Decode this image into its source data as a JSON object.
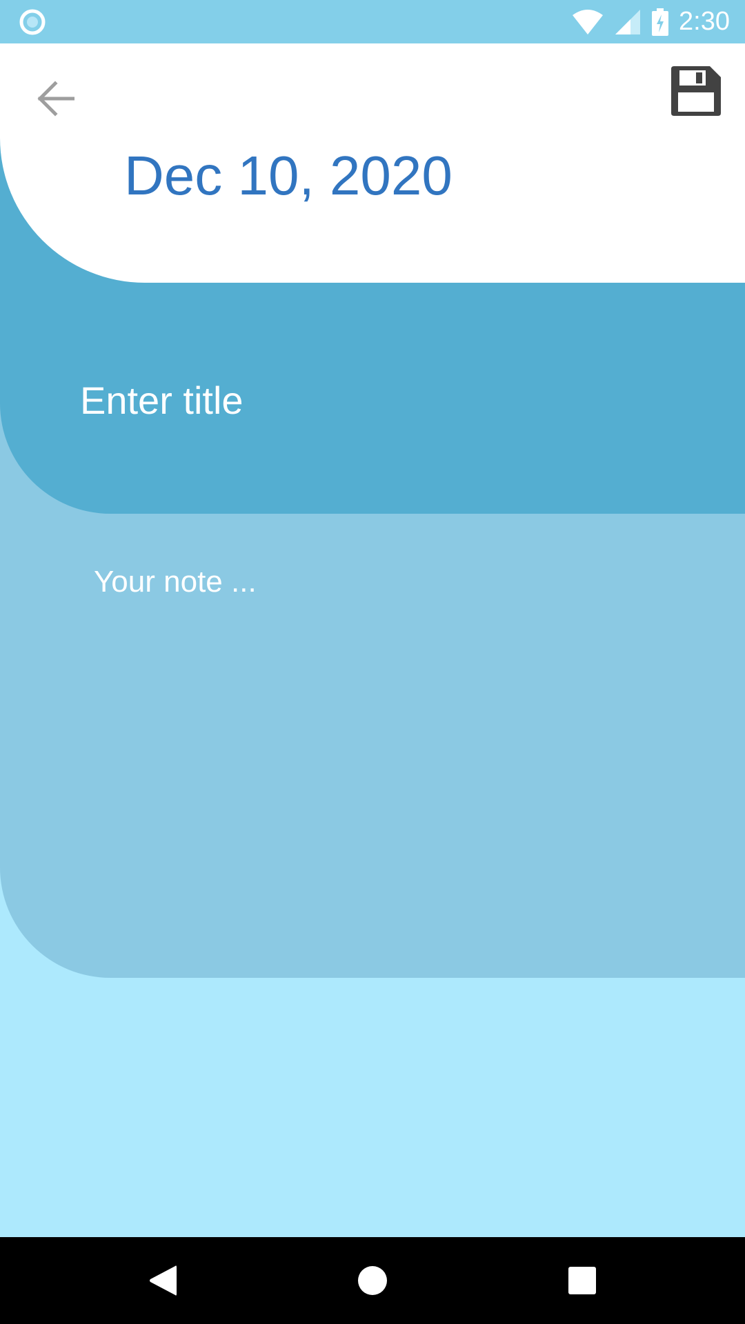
{
  "status_bar": {
    "time": "2:30",
    "icons": [
      "app-notification-icon",
      "wifi-icon",
      "cell-signal-icon",
      "battery-charging-icon"
    ],
    "background": "#83cfe9"
  },
  "header": {
    "date": "Dec 10, 2020",
    "back_icon": "arrow-left-icon",
    "save_icon": "floppy-disk-icon",
    "date_color": "#3175c0"
  },
  "title_field": {
    "placeholder": "Enter title",
    "value": ""
  },
  "note_field": {
    "placeholder": "Your note ...",
    "value": ""
  },
  "nav_bar": {
    "icons": [
      "nav-back-icon",
      "nav-home-icon",
      "nav-recents-icon"
    ]
  },
  "colors": {
    "page_background": "#ade9fd",
    "title_card": "#54aed1",
    "note_card": "#8bc9e3",
    "header_card": "#ffffff"
  }
}
